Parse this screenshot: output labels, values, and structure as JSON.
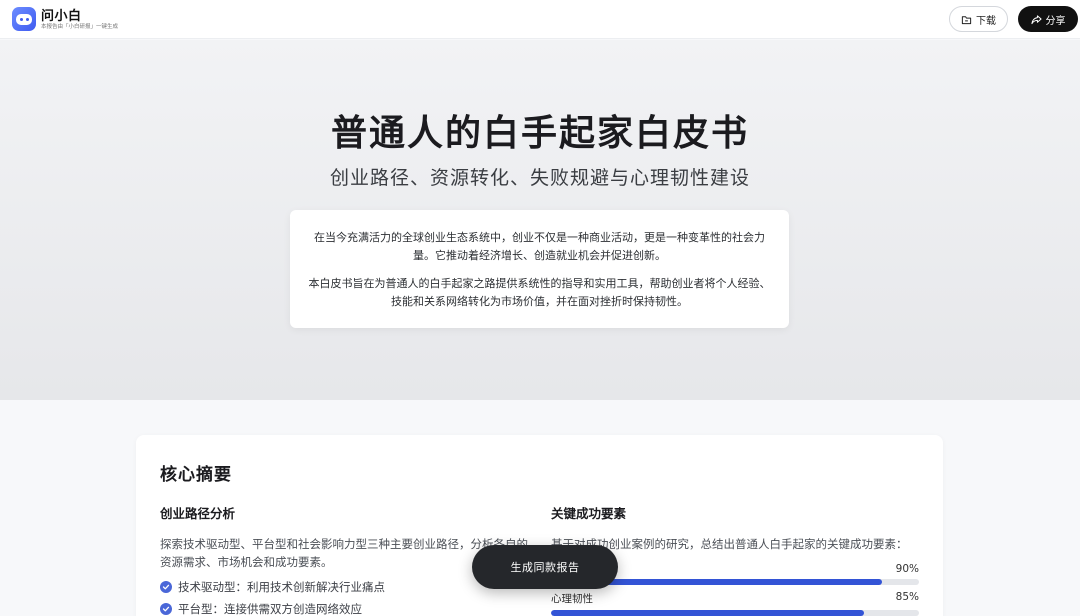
{
  "header": {
    "brand_name": "问小白",
    "brand_sub": "本报告由「小白研报」一键生成",
    "download_label": "下载",
    "share_label": "分享"
  },
  "hero": {
    "title": "普通人的白手起家白皮书",
    "subtitle": "创业路径、资源转化、失败规避与心理韧性建设",
    "intro_p1": "在当今充满活力的全球创业生态系统中，创业不仅是一种商业活动，更是一种变革性的社会力量。它推动着经济增长、创造就业机会并促进创新。",
    "intro_p2": "本白皮书旨在为普通人的白手起家之路提供系统性的指导和实用工具，帮助创业者将个人经验、技能和关系网络转化为市场价值，并在面对挫折时保持韧性。"
  },
  "summary": {
    "title": "核心摘要",
    "left": {
      "heading": "创业路径分析",
      "text": "探索技术驱动型、平台型和社会影响力型三种主要创业路径，分析各自的资源需求、市场机会和成功要素。",
      "bullets": [
        "技术驱动型：利用技术创新解决行业痛点",
        "平台型：连接供需双方创造网络效应"
      ]
    },
    "right": {
      "heading": "关键成功要素",
      "text": "基于对成功创业案例的研究，总结出普通人白手起家的关键成功要素：",
      "metrics": [
        {
          "label": "",
          "value": "90%",
          "fraction": 0.9
        },
        {
          "label": "心理韧性",
          "value": "85%",
          "fraction": 0.85
        }
      ]
    }
  },
  "cta_label": "生成同款报告",
  "colors": {
    "accent": "#3354d6",
    "check": "#4a67d8",
    "cta_bg": "#25272b"
  }
}
